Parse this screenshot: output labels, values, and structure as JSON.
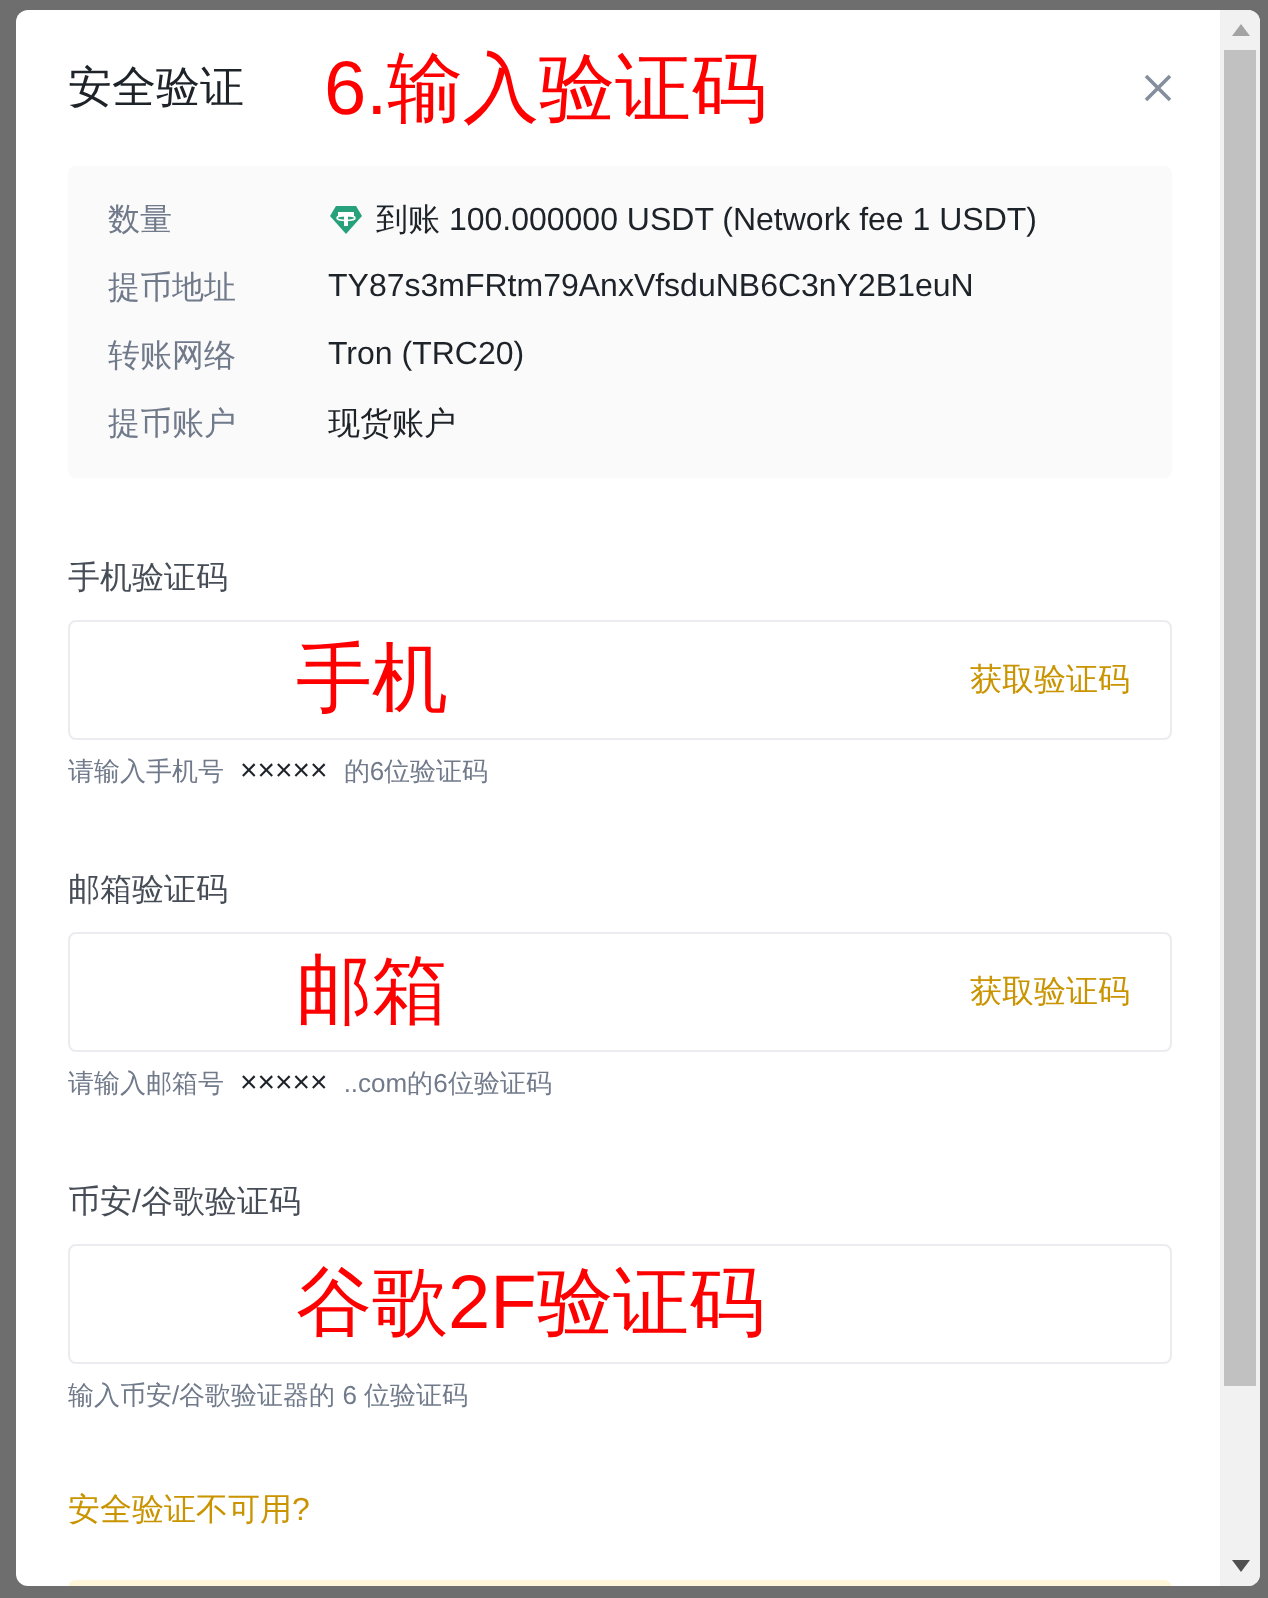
{
  "dialog": {
    "title": "安全验证",
    "annotation": "6.输入验证码"
  },
  "details": [
    {
      "label": "数量",
      "value": "到账 100.000000 USDT (Network fee 1 USDT)",
      "kind": "amount"
    },
    {
      "label": "提币地址",
      "value": "TY87s3mFRtm79AnxVfsduNB6C3nY2B1euN",
      "kind": "text"
    },
    {
      "label": "转账网络",
      "value": "Tron (TRC20)",
      "kind": "text"
    },
    {
      "label": "提币账户",
      "value": "现货账户",
      "kind": "text"
    }
  ],
  "fields": [
    {
      "label": "手机验证码",
      "annotation": "手机",
      "button": "获取验证码",
      "hint_prefix": "请输入手机号",
      "hint_masked": "×××××",
      "hint_suffix": "的6位验证码"
    },
    {
      "label": "邮箱验证码",
      "annotation": "邮箱",
      "button": "获取验证码",
      "hint_prefix": "请输入邮箱号",
      "hint_masked": "×××××",
      "hint_suffix": "..com的6位验证码"
    },
    {
      "label": "币安/谷歌验证码",
      "annotation": "谷歌2F验证码",
      "hint_prefix": "输入币安/谷歌验证器的 6 位验证码"
    }
  ],
  "help_link": "安全验证不可用?"
}
